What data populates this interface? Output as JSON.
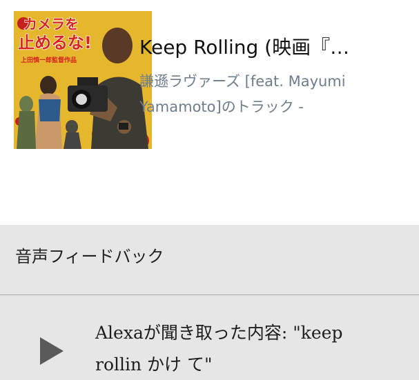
{
  "track": {
    "title": "Keep Rolling (映画『…",
    "subtitle": "謙遜ラヴァーズ [feat. Mayumi Yamamoto]のトラック -",
    "album_art": {
      "headline_line1": "カメラを",
      "headline_line2": "止めるな!",
      "credit": "上田慎一郎監督作品"
    }
  },
  "feedback": {
    "title": "音声フィードバック",
    "heard_text": "Alexaが聞き取った内容: \"keep rollin かけ て\"",
    "play_icon": "play-icon"
  },
  "colors": {
    "album_background": "#e6b62d",
    "title_red": "#d8231f",
    "subtitle": "#6e7d8c",
    "panel_background": "#e6e6e6",
    "play_icon": "#5a5a5a"
  }
}
